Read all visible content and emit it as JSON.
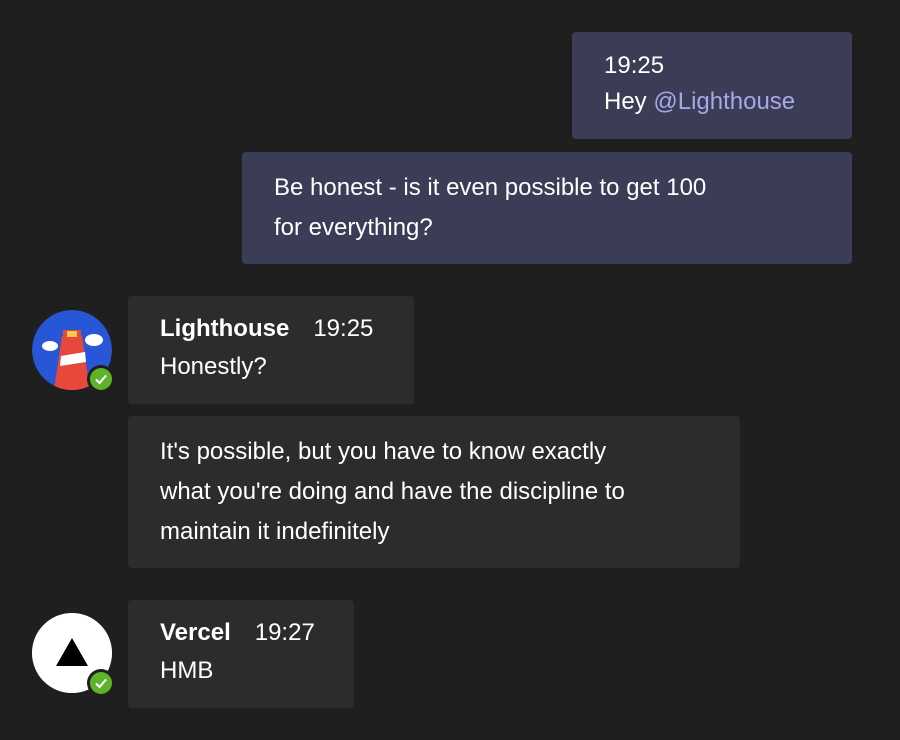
{
  "messages": {
    "out1": {
      "time": "19:25",
      "greeting": "Hey ",
      "mention": "@Lighthouse"
    },
    "out2": {
      "line1": "Be honest - is it even possible to get 100",
      "line2": "for everything?"
    },
    "lighthouse": {
      "sender": "Lighthouse",
      "time": "19:25",
      "text": "Honestly?",
      "followup_line1": "It's possible, but you have to know exactly",
      "followup_line2": "what you're doing and have the discipline to",
      "followup_line3": "maintain it indefinitely"
    },
    "vercel": {
      "sender": "Vercel",
      "time": "19:27",
      "text": "HMB"
    }
  },
  "avatars": {
    "lighthouse": {
      "icon": "lighthouse-icon",
      "presence": "available"
    },
    "vercel": {
      "icon": "vercel-triangle-icon",
      "presence": "available"
    }
  },
  "colors": {
    "background": "#1f1f1f",
    "outgoing_bubble": "#3b3c56",
    "incoming_bubble": "#2c2c2c",
    "mention": "#a9a7e6",
    "presence_available": "#5fb32b"
  }
}
